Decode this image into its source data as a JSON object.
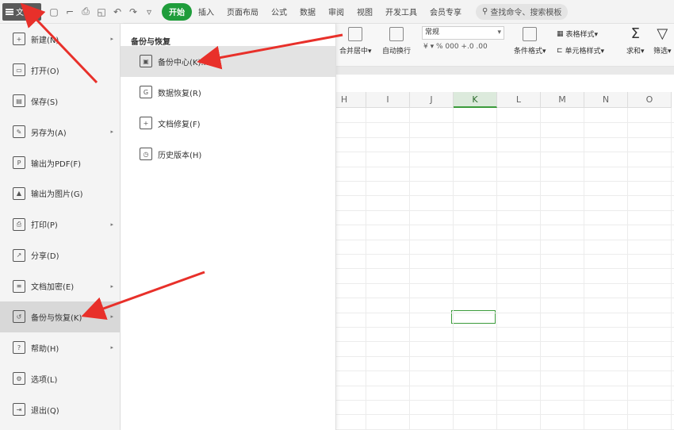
{
  "topbar": {
    "file_label": "文件",
    "tabs": [
      "开始",
      "插入",
      "页面布局",
      "公式",
      "数据",
      "审阅",
      "视图",
      "开发工具",
      "会员专享"
    ],
    "search_placeholder": "查找命令、搜索模板"
  },
  "ribbon": {
    "merge_label": "合并居中▾",
    "wrap_label": "自动换行",
    "number_format": "常规",
    "number_buttons": "¥ ▾  %  000  +.0  .00",
    "conditional_format": "条件格式▾",
    "table_style": "表格样式▾",
    "cell_style": "单元格样式▾",
    "sum_label": "求和▾",
    "filter_label": "筛选▾"
  },
  "grid": {
    "columns": [
      "H",
      "I",
      "J",
      "K",
      "L",
      "M",
      "N",
      "O"
    ],
    "selected_column": "K"
  },
  "file_menu": {
    "items": [
      {
        "label": "新建(N)",
        "icon": "new-icon",
        "glyph": "+",
        "submenu": true
      },
      {
        "label": "打开(O)",
        "icon": "open-folder-icon",
        "glyph": "▭",
        "submenu": false
      },
      {
        "label": "保存(S)",
        "icon": "save-icon",
        "glyph": "▤",
        "submenu": false
      },
      {
        "label": "另存为(A)",
        "icon": "save-as-icon",
        "glyph": "✎",
        "submenu": true
      },
      {
        "label": "输出为PDF(F)",
        "icon": "pdf-icon",
        "glyph": "P",
        "submenu": false
      },
      {
        "label": "输出为图片(G)",
        "icon": "image-icon",
        "glyph": "▲",
        "submenu": false
      },
      {
        "label": "打印(P)",
        "icon": "print-icon",
        "glyph": "⎙",
        "submenu": true
      },
      {
        "label": "分享(D)",
        "icon": "share-icon",
        "glyph": "↗",
        "submenu": false
      },
      {
        "label": "文档加密(E)",
        "icon": "encrypt-icon",
        "glyph": "≡",
        "submenu": true
      },
      {
        "label": "备份与恢复(K)",
        "icon": "backup-restore-icon",
        "glyph": "↺",
        "submenu": true,
        "active": true
      },
      {
        "label": "帮助(H)",
        "icon": "help-icon",
        "glyph": "?",
        "submenu": true
      },
      {
        "label": "选项(L)",
        "icon": "options-gear-icon",
        "glyph": "⚙",
        "submenu": false
      },
      {
        "label": "退出(Q)",
        "icon": "exit-icon",
        "glyph": "⇥",
        "submenu": false
      }
    ]
  },
  "submenu": {
    "title": "备份与恢复",
    "items": [
      {
        "label": "备份中心(K)...",
        "icon": "backup-center-icon",
        "glyph": "▣",
        "hover": true
      },
      {
        "label": "数据恢复(R)",
        "icon": "data-recovery-icon",
        "glyph": "G"
      },
      {
        "label": "文档修复(F)",
        "icon": "document-repair-icon",
        "glyph": "+"
      },
      {
        "label": "历史版本(H)",
        "icon": "history-version-icon",
        "glyph": "◷"
      }
    ]
  },
  "colors": {
    "accent_green": "#1f9d3b",
    "annotation_red": "#e8302a"
  }
}
